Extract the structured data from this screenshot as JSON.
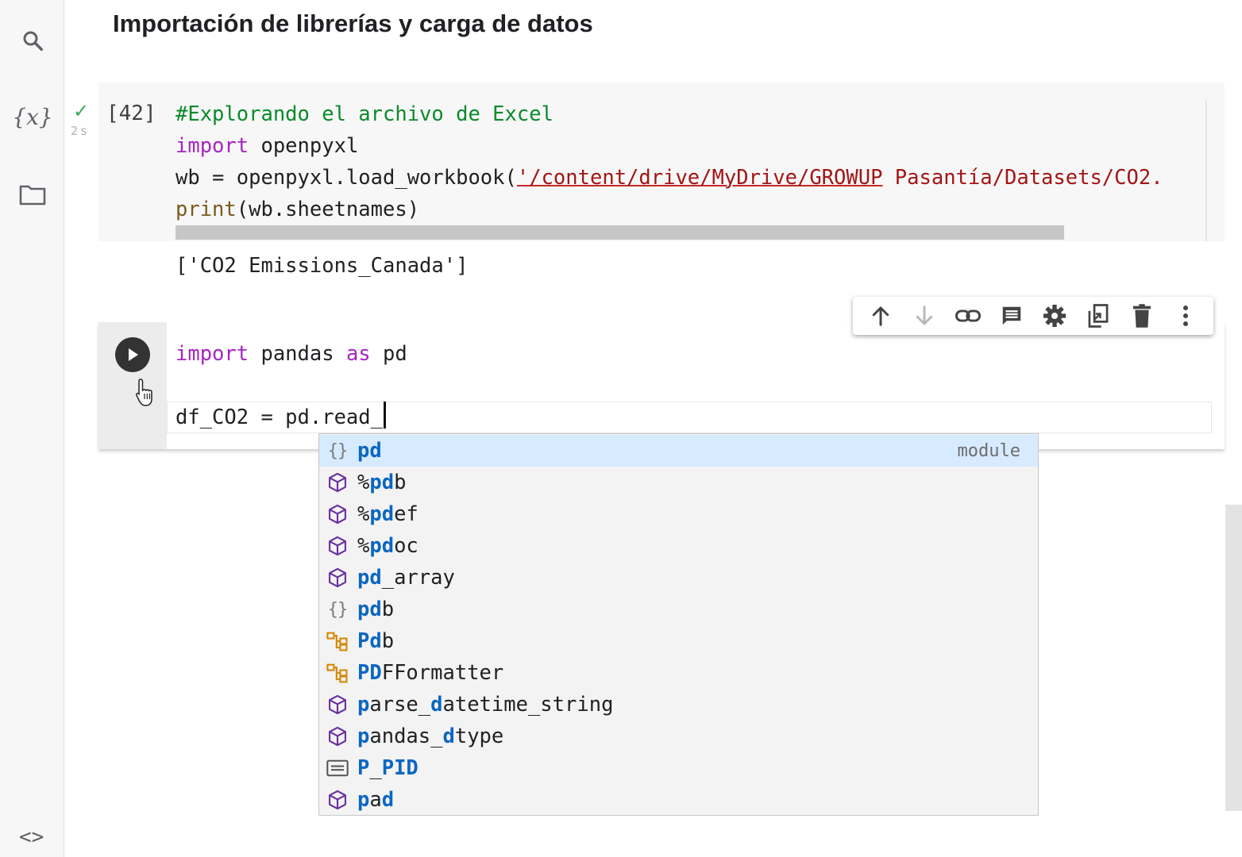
{
  "sidebar": {
    "icons": [
      "search-icon",
      "variables-icon",
      "folder-icon",
      "code-snippets-icon"
    ],
    "variables_label": "{x}",
    "code_label": "<>"
  },
  "heading": "Importación de librerías y carga de datos",
  "cell1": {
    "status_icon": "check-icon",
    "exec_time": "2s",
    "exec_count": "[42]",
    "lines": {
      "l1_comment": "#Explorando el archivo de Excel",
      "l2_kw": "import",
      "l2_rest": " openpyxl",
      "l3_pre": "wb = openpyxl.load_workbook(",
      "l3_str_err": "'/content/drive/MyDrive/GROWUP",
      "l3_str_rest": " Pasantía/Datasets/CO2.",
      "l4_fn": "print",
      "l4_rest": "(wb.sheetnames)"
    },
    "output": "['CO2 Emissions_Canada']"
  },
  "toolbar": {
    "buttons": [
      "move-up-icon",
      "move-down-icon",
      "link-icon",
      "comment-icon",
      "settings-icon",
      "mirror-cell-icon",
      "delete-icon",
      "more-icon"
    ]
  },
  "cell2": {
    "run_icon": "play-icon",
    "line1_kw1": "import",
    "line1_mid": " pandas ",
    "line1_kw2": "as",
    "line1_end": " pd",
    "line3": "df_CO2 = pd.read_"
  },
  "autocomplete": {
    "items": [
      {
        "icon": "module",
        "match": "pd",
        "rest": "",
        "detail": "module"
      },
      {
        "icon": "cube",
        "match": "",
        "rest": "%pdb",
        "detail": ""
      },
      {
        "icon": "cube",
        "match": "",
        "rest": "%pdef",
        "detail": ""
      },
      {
        "icon": "cube",
        "match": "",
        "rest": "%pdoc",
        "detail": ""
      },
      {
        "icon": "cube",
        "match": "pd",
        "rest": "_array",
        "detail": ""
      },
      {
        "icon": "module",
        "match": "pd",
        "rest": "b",
        "detail": ""
      },
      {
        "icon": "class",
        "match": "P",
        "rest": "db",
        "detail": ""
      },
      {
        "icon": "class",
        "match": "PD",
        "rest": "FFormatter",
        "detail": ""
      },
      {
        "icon": "cube",
        "match": "",
        "rest": "parse_datetime_string",
        "detail": ""
      },
      {
        "icon": "cube",
        "match": "",
        "rest": "pandas_dtype",
        "detail": ""
      },
      {
        "icon": "constant",
        "match": "P",
        "rest": "_PID",
        "detail": ""
      },
      {
        "icon": "cube",
        "match": "",
        "rest": "pad",
        "detail": ""
      }
    ],
    "item_segments": [
      [
        {
          "t": "pd",
          "m": true
        }
      ],
      [
        {
          "t": "%",
          "m": false
        },
        {
          "t": "pd",
          "m": true
        },
        {
          "t": "b",
          "m": false
        }
      ],
      [
        {
          "t": "%",
          "m": false
        },
        {
          "t": "pd",
          "m": true
        },
        {
          "t": "ef",
          "m": false
        }
      ],
      [
        {
          "t": "%",
          "m": false
        },
        {
          "t": "pd",
          "m": true
        },
        {
          "t": "oc",
          "m": false
        }
      ],
      [
        {
          "t": "pd",
          "m": true
        },
        {
          "t": "_array",
          "m": false
        }
      ],
      [
        {
          "t": "pd",
          "m": true
        },
        {
          "t": "b",
          "m": false
        }
      ],
      [
        {
          "t": "P",
          "m": true
        },
        {
          "t": "d",
          "m": true
        },
        {
          "t": "b",
          "m": false
        }
      ],
      [
        {
          "t": "PD",
          "m": true
        },
        {
          "t": "FFormatter",
          "m": false
        }
      ],
      [
        {
          "t": "p",
          "m": true
        },
        {
          "t": "arse_",
          "m": false
        },
        {
          "t": "d",
          "m": true
        },
        {
          "t": "atetime_string",
          "m": false
        }
      ],
      [
        {
          "t": "p",
          "m": true
        },
        {
          "t": "andas_",
          "m": false
        },
        {
          "t": "d",
          "m": true
        },
        {
          "t": "type",
          "m": false
        }
      ],
      [
        {
          "t": "P",
          "m": true
        },
        {
          "t": "_",
          "m": false
        },
        {
          "t": "PID",
          "m": true
        }
      ],
      [
        {
          "t": "p",
          "m": true
        },
        {
          "t": "a",
          "m": false
        },
        {
          "t": "d",
          "m": true
        }
      ]
    ]
  },
  "colors": {
    "comment": "#0a8a2a",
    "keyword": "#a626c2",
    "string": "#a31515",
    "match": "#0b66c2",
    "selection": "#d6ebff",
    "success": "#34a853"
  }
}
